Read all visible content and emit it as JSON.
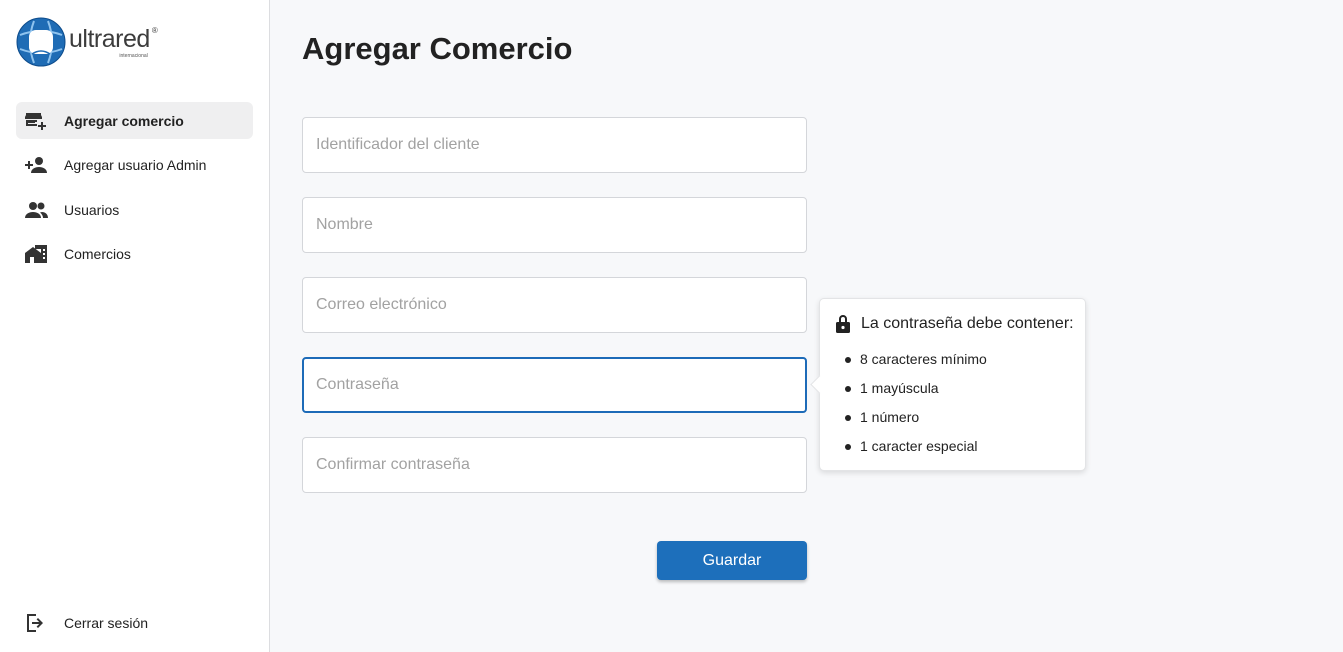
{
  "brand": {
    "name": "ultrared",
    "registered": "®",
    "subtitle": "internacional",
    "colors": {
      "blue": "#1d6fbb",
      "dark": "#3c3c3c"
    }
  },
  "sidebar": {
    "items": [
      {
        "label": "Agregar comercio",
        "icon": "store-add-icon",
        "active": true
      },
      {
        "label": "Agregar usuario Admin",
        "icon": "person-add-icon",
        "active": false
      },
      {
        "label": "Usuarios",
        "icon": "people-icon",
        "active": false
      },
      {
        "label": "Comercios",
        "icon": "buildings-icon",
        "active": false
      }
    ],
    "logout_label": "Cerrar sesión"
  },
  "main": {
    "title": "Agregar Comercio",
    "fields": {
      "client_id_placeholder": "Identificador del cliente",
      "name_placeholder": "Nombre",
      "email_placeholder": "Correo electrónico",
      "password_placeholder": "Contraseña",
      "confirm_placeholder": "Confirmar contraseña"
    },
    "save_label": "Guardar"
  },
  "password_tooltip": {
    "title": "La contraseña debe contener:",
    "icon": "lock-icon",
    "rules": [
      "8 caracteres mínimo",
      "1 mayúscula",
      "1 número",
      "1 caracter especial"
    ]
  },
  "colors": {
    "accent": "#1d6fbb",
    "focus_border": "#1d6bb8",
    "background": "#f7f8fa"
  }
}
